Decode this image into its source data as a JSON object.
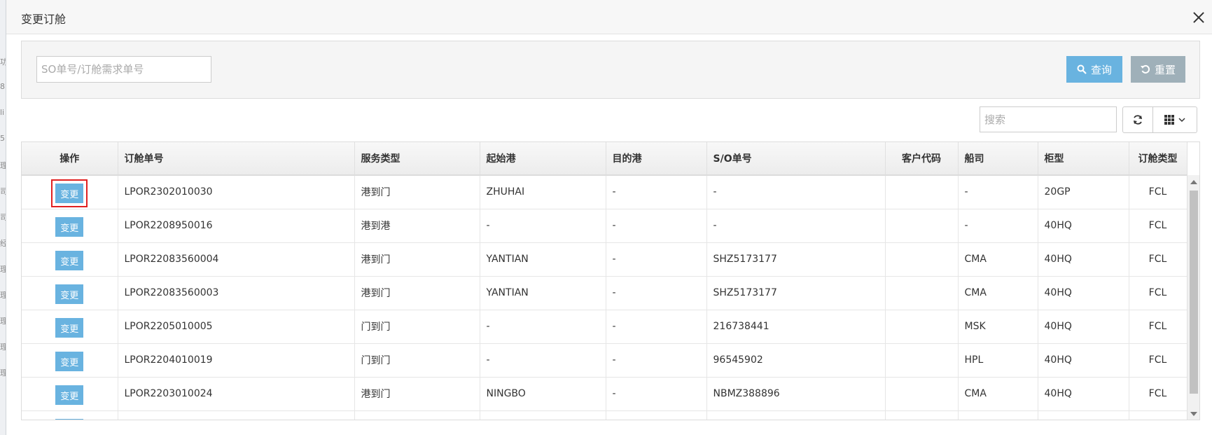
{
  "backdrop": {
    "fragments": [
      "功",
      "8",
      "li",
      "5",
      "理",
      "司",
      "司",
      "经",
      "理",
      "理",
      "理",
      "理",
      "理"
    ]
  },
  "modal": {
    "title": "变更订舱"
  },
  "search": {
    "placeholder": "SO单号/订舱需求单号",
    "query_label": "查询",
    "reset_label": "重置"
  },
  "toolbar": {
    "search_placeholder": "搜索"
  },
  "table": {
    "headers": {
      "action": "操作",
      "booking_no": "订舱单号",
      "service_type": "服务类型",
      "origin_port": "起始港",
      "dest_port": "目的港",
      "so_no": "S/O单号",
      "customer_code": "客户代码",
      "carrier": "船司",
      "container_type": "柜型",
      "booking_type": "订舱类型"
    },
    "action_label": "变更",
    "rows": [
      {
        "booking_no": "LPOR2302010030",
        "service_type": "港到门",
        "origin_port": "ZHUHAI",
        "dest_port": "-",
        "so_no": "-",
        "customer_code": "",
        "carrier": "-",
        "container_type": "20GP",
        "booking_type": "FCL"
      },
      {
        "booking_no": "LPOR2208950016",
        "service_type": "港到港",
        "origin_port": "-",
        "dest_port": "-",
        "so_no": "-",
        "customer_code": "",
        "carrier": "-",
        "container_type": "40HQ",
        "booking_type": "FCL"
      },
      {
        "booking_no": "LPOR22083560004",
        "service_type": "港到门",
        "origin_port": "YANTIAN",
        "dest_port": "-",
        "so_no": "SHZ5173177",
        "customer_code": "",
        "carrier": "CMA",
        "container_type": "40HQ",
        "booking_type": "FCL"
      },
      {
        "booking_no": "LPOR22083560003",
        "service_type": "港到门",
        "origin_port": "YANTIAN",
        "dest_port": "-",
        "so_no": "SHZ5173177",
        "customer_code": "",
        "carrier": "CMA",
        "container_type": "40HQ",
        "booking_type": "FCL"
      },
      {
        "booking_no": "LPOR2205010005",
        "service_type": "门到门",
        "origin_port": "-",
        "dest_port": "-",
        "so_no": "216738441",
        "customer_code": "",
        "carrier": "MSK",
        "container_type": "40HQ",
        "booking_type": "FCL"
      },
      {
        "booking_no": "LPOR2204010019",
        "service_type": "门到门",
        "origin_port": "-",
        "dest_port": "-",
        "so_no": "96545902",
        "customer_code": "",
        "carrier": "HPL",
        "container_type": "40HQ",
        "booking_type": "FCL"
      },
      {
        "booking_no": "LPOR2203010024",
        "service_type": "港到门",
        "origin_port": "NINGBO",
        "dest_port": "-",
        "so_no": "NBMZ388896",
        "customer_code": "",
        "carrier": "CMA",
        "container_type": "40HQ",
        "booking_type": "FCL"
      },
      {
        "booking_no": "",
        "service_type": "",
        "origin_port": "",
        "dest_port": "",
        "so_no": "",
        "customer_code": "",
        "carrier": "",
        "container_type": "",
        "booking_type": ""
      }
    ]
  },
  "colors": {
    "primary_button": "#69b3e0",
    "reset_button": "#9fb0b9",
    "highlight": "#e02020"
  }
}
